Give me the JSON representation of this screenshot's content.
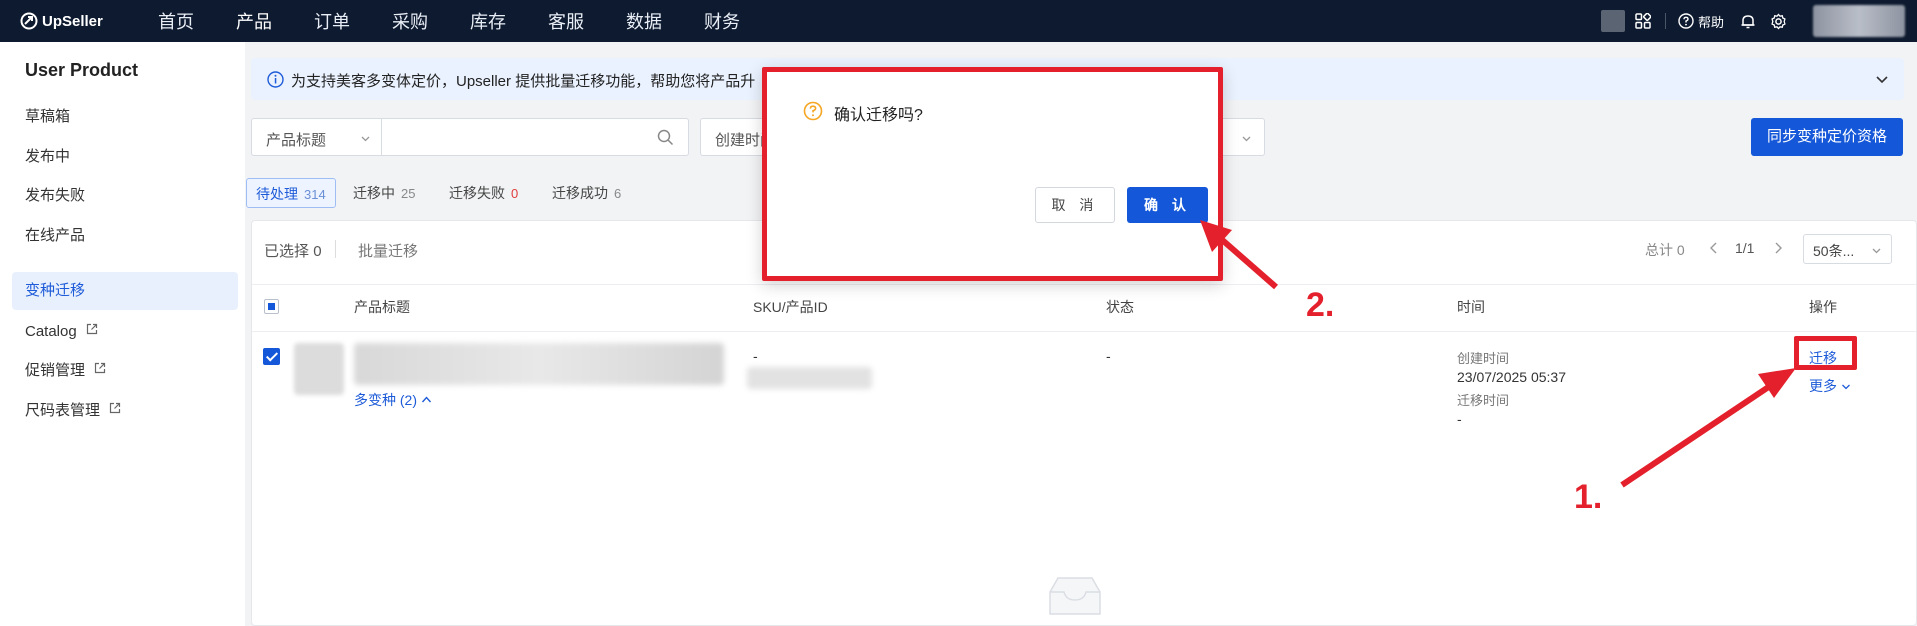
{
  "brand": {
    "name": "UpSeller"
  },
  "topnav": {
    "menu": [
      "首页",
      "产品",
      "订单",
      "采购",
      "库存",
      "客服",
      "数据",
      "财务"
    ],
    "active": "产品",
    "help_label": "帮助"
  },
  "sidebar": {
    "title": "User Product",
    "items": [
      {
        "label": "草稿箱"
      },
      {
        "label": "发布中"
      },
      {
        "label": "发布失败"
      },
      {
        "label": "在线产品"
      },
      {
        "label": "变种迁移",
        "active": true
      },
      {
        "label": "Catalog",
        "external": true
      },
      {
        "label": "促销管理",
        "external": true
      },
      {
        "label": "尺码表管理",
        "external": true
      }
    ]
  },
  "banner": {
    "text": "为支持美客多变体定价，Upseller 提供批量迁移功能，帮助您将产品升"
  },
  "filters": {
    "field_select": "产品标题",
    "search_value": "",
    "date_select": "创建时间",
    "sync_button": "同步变种定价资格"
  },
  "status_tabs": [
    {
      "label": "待处理",
      "count": "314",
      "active": true
    },
    {
      "label": "迁移中",
      "count": "25"
    },
    {
      "label": "迁移失败",
      "count": "0",
      "alert": true
    },
    {
      "label": "迁移成功",
      "count": "6"
    }
  ],
  "toolbar": {
    "selected_label": "已选择",
    "selected_count": "0",
    "bulk_migrate": "批量迁移",
    "total_label": "总计",
    "total_count": "0",
    "page": "1/1",
    "page_size": "50条..."
  },
  "table": {
    "headers": [
      "产品标题",
      "SKU/产品ID",
      "状态",
      "时间",
      "操作"
    ],
    "rows": [
      {
        "variant_link": "多变种 (2)",
        "sku": "-",
        "status": "-",
        "created_label": "创建时间",
        "created_value": "23/07/2025 05:37",
        "migrated_label": "迁移时间",
        "migrated_value": "-",
        "action_migrate": "迁移",
        "action_more": "更多"
      }
    ]
  },
  "modal": {
    "title": "确认迁移吗?",
    "cancel": "取 消",
    "confirm": "确 认"
  },
  "annotations": {
    "step1": "1.",
    "step2": "2."
  },
  "colors": {
    "primary": "#1457d9",
    "nav_bg": "#0d1a2f",
    "annotation_red": "#e3202b",
    "banner_bg": "#eaf2ff"
  }
}
